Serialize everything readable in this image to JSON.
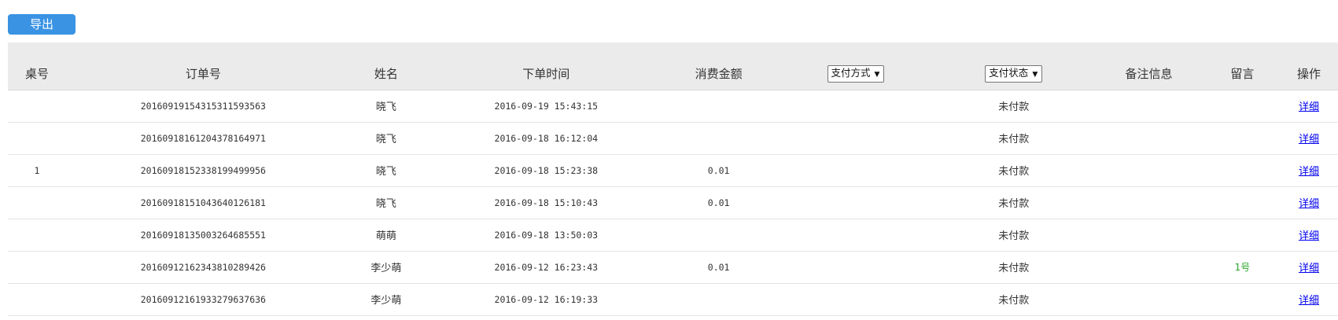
{
  "toolbar": {
    "export_label": "导出"
  },
  "table": {
    "headers": {
      "table_no": "桌号",
      "order_no": "订单号",
      "name": "姓名",
      "order_time": "下单时间",
      "amount": "消费金额",
      "pay_method": "支付方式",
      "pay_status": "支付状态",
      "remark": "备注信息",
      "message": "留言",
      "action": "操作"
    },
    "rows": [
      {
        "table_no": "",
        "order_no": "20160919154315311593563",
        "name": "晓飞",
        "order_time": "2016-09-19 15:43:15",
        "amount": "",
        "pay_method": "",
        "pay_status": "未付款",
        "remark": "",
        "message": "",
        "action": "详细"
      },
      {
        "table_no": "",
        "order_no": "20160918161204378164971",
        "name": "晓飞",
        "order_time": "2016-09-18 16:12:04",
        "amount": "",
        "pay_method": "",
        "pay_status": "未付款",
        "remark": "",
        "message": "",
        "action": "详细"
      },
      {
        "table_no": "1",
        "order_no": "20160918152338199499956",
        "name": "晓飞",
        "order_time": "2016-09-18 15:23:38",
        "amount": "0.01",
        "pay_method": "",
        "pay_status": "未付款",
        "remark": "",
        "message": "",
        "action": "详细"
      },
      {
        "table_no": "",
        "order_no": "20160918151043640126181",
        "name": "晓飞",
        "order_time": "2016-09-18 15:10:43",
        "amount": "0.01",
        "pay_method": "",
        "pay_status": "未付款",
        "remark": "",
        "message": "",
        "action": "详细"
      },
      {
        "table_no": "",
        "order_no": "20160918135003264685551",
        "name": "萌萌",
        "order_time": "2016-09-18 13:50:03",
        "amount": "",
        "pay_method": "",
        "pay_status": "未付款",
        "remark": "",
        "message": "",
        "action": "详细"
      },
      {
        "table_no": "",
        "order_no": "20160912162343810289426",
        "name": "李少萌",
        "order_time": "2016-09-12 16:23:43",
        "amount": "0.01",
        "pay_method": "",
        "pay_status": "未付款",
        "remark": "",
        "message": "1号",
        "action": "详细"
      },
      {
        "table_no": "",
        "order_no": "20160912161933279637636",
        "name": "李少萌",
        "order_time": "2016-09-12 16:19:33",
        "amount": "",
        "pay_method": "",
        "pay_status": "未付款",
        "remark": "",
        "message": "",
        "action": "详细"
      }
    ]
  },
  "colors": {
    "accent": "#3a93e3",
    "header_bg": "#ebebeb",
    "link": "#0000ee",
    "message": "#2aa52a"
  }
}
